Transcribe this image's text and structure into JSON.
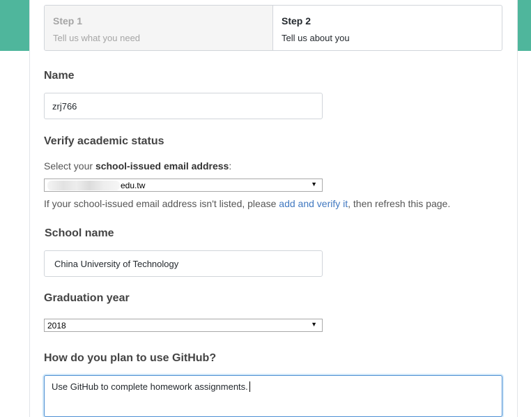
{
  "steps": [
    {
      "title": "Step 1",
      "subtitle": "Tell us what you need",
      "state": "inactive"
    },
    {
      "title": "Step 2",
      "subtitle": "Tell us about you",
      "state": "active"
    }
  ],
  "name_section": {
    "label": "Name",
    "value": "zrj766"
  },
  "verify_section": {
    "label": "Verify academic status",
    "select_prefix": "Select your ",
    "select_bold": "school-issued email address",
    "select_suffix": ":",
    "email_selected": "edu.tw",
    "help_prefix": "If your school-issued email address isn't listed, please ",
    "help_link": "add and verify it",
    "help_suffix": ", then refresh this page."
  },
  "school_section": {
    "label": "School name",
    "value": "China University of Technology"
  },
  "graduation_section": {
    "label": "Graduation year",
    "selected": "2018"
  },
  "usage_section": {
    "label": "How do you plan to use GitHub?",
    "value": "Use GitHub to complete homework assignments."
  },
  "colors": {
    "accent_band": "#4fb69c",
    "link": "#4078c0",
    "focus": "#4e8fd3"
  }
}
